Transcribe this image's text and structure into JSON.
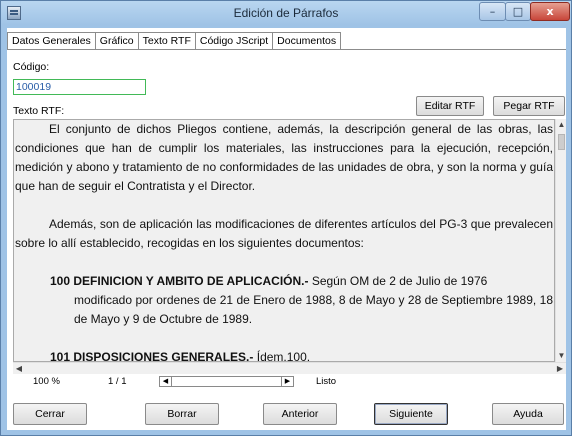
{
  "window": {
    "title": "Edición de Párrafos"
  },
  "window_controls": {
    "minimize": "–",
    "maximize": "□",
    "close": "x"
  },
  "tabs": [
    {
      "label": "Datos Generales"
    },
    {
      "label": "Gráfico"
    },
    {
      "label": "Texto RTF"
    },
    {
      "label": "Código JScript"
    },
    {
      "label": "Documentos"
    }
  ],
  "active_tab": "Texto RTF",
  "codigo": {
    "label": "Código:",
    "value": "100019"
  },
  "rtf": {
    "label": "Texto RTF:",
    "editar_label": "Editar RTF",
    "pegar_label": "Pegar RTF",
    "paragraph1": "El conjunto de dichos Pliegos contiene, además, la descripción general de las obras, las condiciones que han de cumplir los materiales, las instrucciones para la ejecución, recepción, medición y abono y tratamiento de no conformidades de las unidades de obra, y son la norma y guía que han de seguir el Contratista y el Director.",
    "paragraph2": "Además, son de aplicación las modificaciones de diferentes artículos del PG-3 que prevalecen sobre lo allí establecido, recogidas en los siguientes documentos:",
    "item1_heading": "100 DEFINICION Y AMBITO DE APLICACIÓN.-",
    "item1_text": "Según OM de 2 de Julio de 1976",
    "item1_cont": "modificado por ordenes de 21 de Enero de 1988, 8 de Mayo y 28 de Septiembre 1989, 18 de Mayo y 9 de Octubre de 1989.",
    "item2_heading": "101 DISPOSICIONES GENERALES.-",
    "item2_text": "Ídem.100."
  },
  "status": {
    "zoom": "100 %",
    "pages": "1 / 1",
    "state": "Listo"
  },
  "buttons": {
    "cerrar": "Cerrar",
    "borrar": "Borrar",
    "anterior": "Anterior",
    "siguiente": "Siguiente",
    "ayuda": "Ayuda"
  },
  "icons": {
    "app": "paragraph-editor-icon",
    "scroll_up": "chevron-up-icon",
    "scroll_down": "chevron-down-icon",
    "scroll_left": "chevron-left-icon",
    "scroll_right": "chevron-right-icon"
  }
}
